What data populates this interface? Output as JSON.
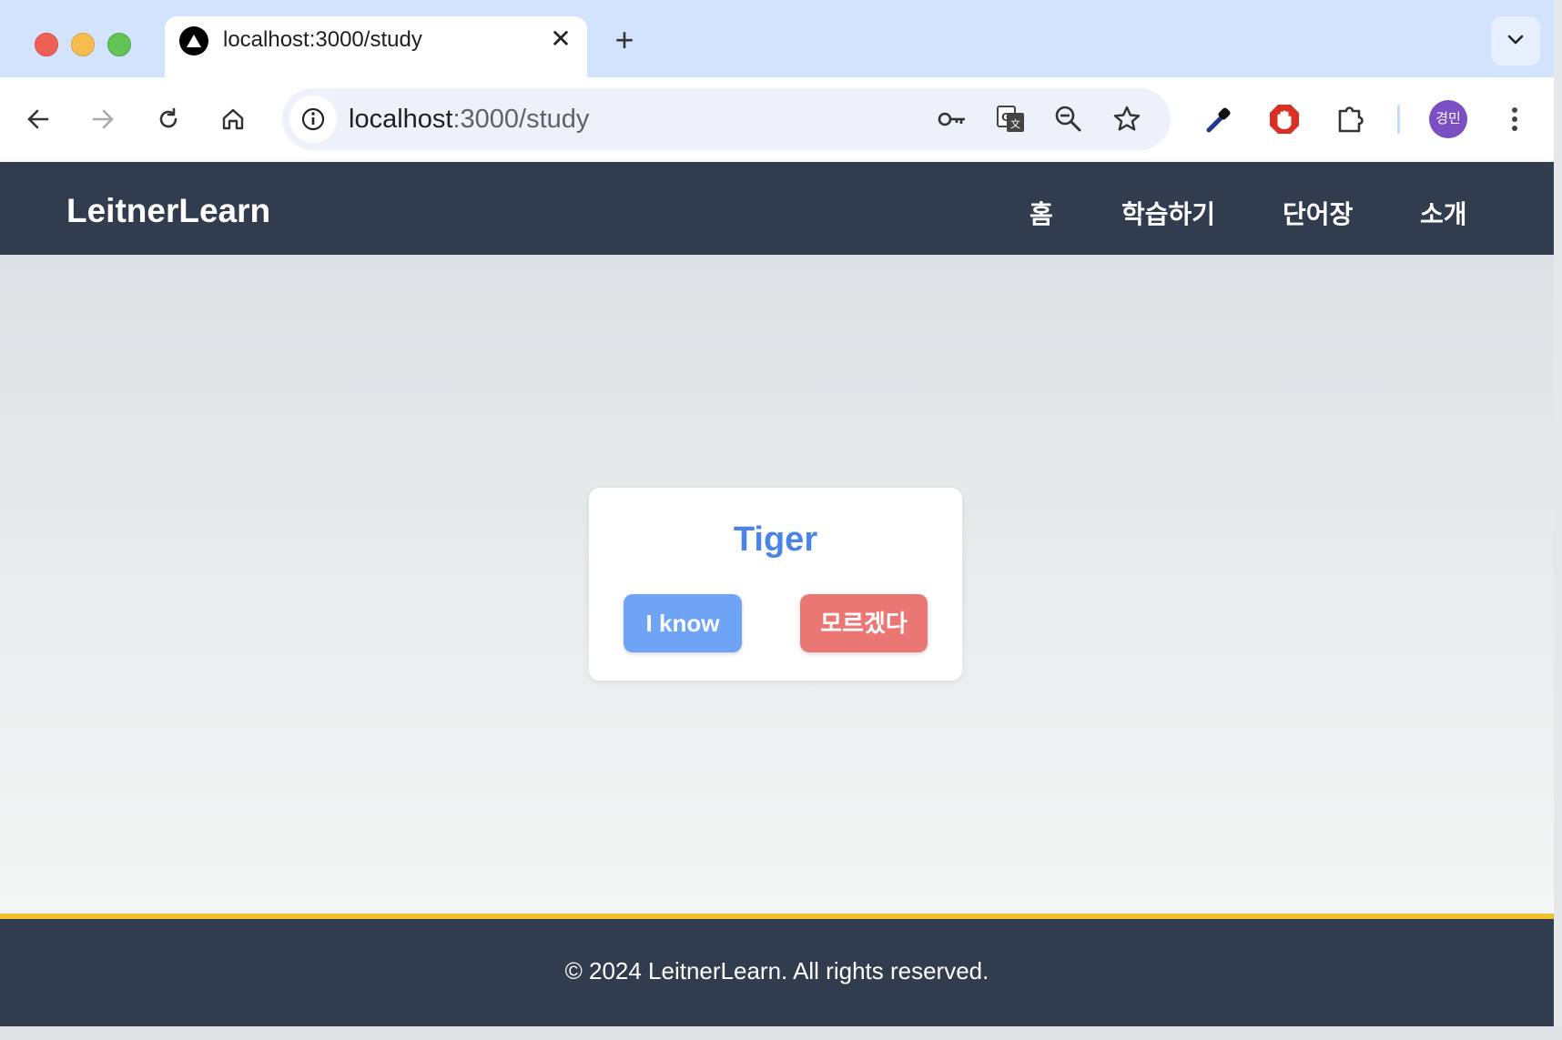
{
  "browser": {
    "tab": {
      "title": "localhost:3000/study",
      "close": "✕"
    },
    "new_tab": "+",
    "url": {
      "host": "localhost",
      "path": ":3000/study"
    },
    "profile_initials": "경민"
  },
  "app": {
    "brand": "LeitnerLearn",
    "nav": [
      "홈",
      "학습하기",
      "단어장",
      "소개"
    ],
    "card": {
      "word": "Tiger",
      "know_label": "I know",
      "dont_know_label": "모르겠다"
    },
    "footer": "© 2024 LeitnerLearn. All rights reserved.",
    "colors": {
      "header_bg": "#313d4f",
      "word": "#4a84e6",
      "know_button": "#6fa3f6",
      "dont_know_button": "#eb7775",
      "footer_accent": "#f0c030"
    }
  }
}
